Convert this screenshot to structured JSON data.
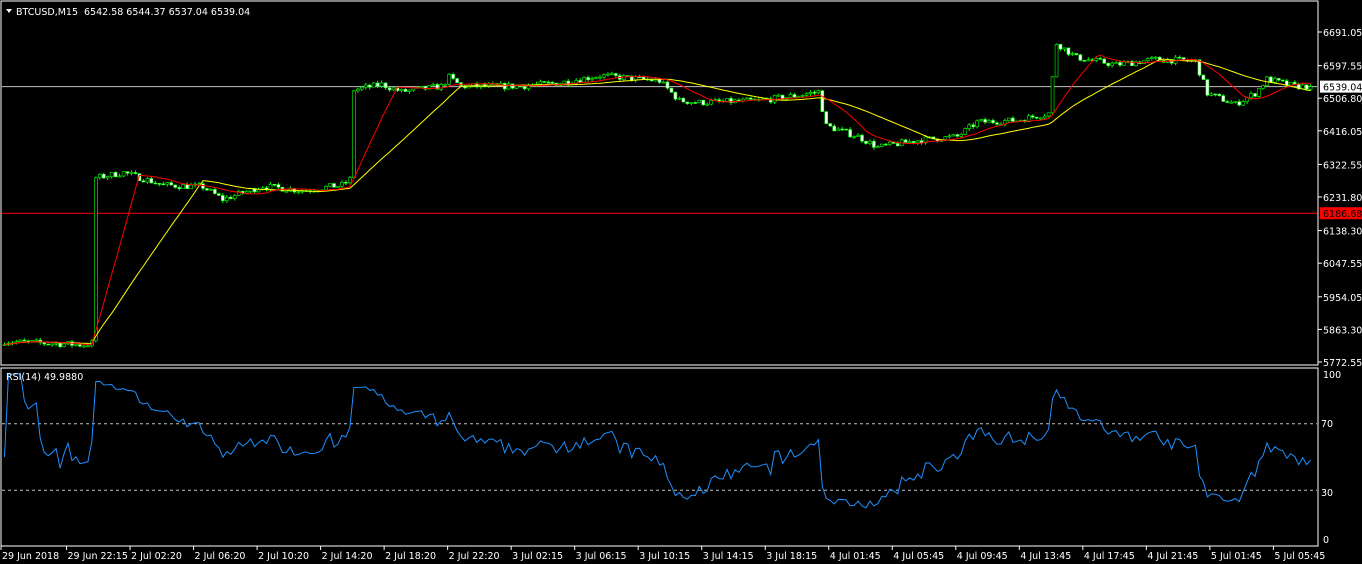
{
  "header": {
    "symbol": "BTCUSD,M15",
    "ohlc": "6542.58 6544.37 6537.04 6539.04"
  },
  "rsi_panel": {
    "label": "RSI(14) 49.9880",
    "levels": [
      "100",
      "70",
      "30",
      "0"
    ]
  },
  "price_axis": {
    "ticks": [
      "6691.05",
      "6597.55",
      "6506.80",
      "6416.05",
      "6322.55",
      "6231.80",
      "6138.30",
      "6047.55",
      "5954.05",
      "5863.30",
      "5772.55"
    ],
    "current_price_label": "6539.04",
    "line_price_label": "6186.68"
  },
  "time_axis": {
    "labels": [
      "29 Jun 2018",
      "29 Jun 22:15",
      "2 Jul 02:20",
      "2 Jul 06:20",
      "2 Jul 10:20",
      "2 Jul 14:20",
      "2 Jul 18:20",
      "2 Jul 22:20",
      "3 Jul 02:15",
      "3 Jul 06:15",
      "3 Jul 10:15",
      "3 Jul 14:15",
      "3 Jul 18:15",
      "4 Jul 01:45",
      "4 Jul 05:45",
      "4 Jul 09:45",
      "4 Jul 13:45",
      "4 Jul 17:45",
      "4 Jul 21:45",
      "5 Jul 01:45",
      "5 Jul 05:45"
    ]
  },
  "colors": {
    "background": "#000000",
    "candle": "#00ff00",
    "bull_body": "#000000",
    "bear_body": "#ffffff",
    "ma_fast": "#ff0000",
    "ma_slow": "#ffff00",
    "rsi": "#1e90ff",
    "current_price_line": "#c0c0c0",
    "hline": "#ff0000"
  },
  "chart_data": {
    "type": "candlestick",
    "symbol": "BTCUSD",
    "timeframe": "M15",
    "price_range": [
      5772.55,
      6691.05
    ],
    "bars": 330,
    "bars_per_time_label": 16,
    "close_keypoints": [
      [
        0,
        5830
      ],
      [
        20,
        5820
      ],
      [
        22,
        5825
      ],
      [
        23,
        6285
      ],
      [
        30,
        6300
      ],
      [
        40,
        6265
      ],
      [
        50,
        6260
      ],
      [
        55,
        6225
      ],
      [
        65,
        6262
      ],
      [
        75,
        6250
      ],
      [
        85,
        6265
      ],
      [
        87,
        6280
      ],
      [
        88,
        6530
      ],
      [
        95,
        6545
      ],
      [
        100,
        6525
      ],
      [
        110,
        6540
      ],
      [
        112,
        6565
      ],
      [
        115,
        6540
      ],
      [
        130,
        6540
      ],
      [
        140,
        6550
      ],
      [
        150,
        6570
      ],
      [
        165,
        6555
      ],
      [
        170,
        6500
      ],
      [
        175,
        6495
      ],
      [
        190,
        6500
      ],
      [
        200,
        6515
      ],
      [
        205,
        6525
      ],
      [
        207,
        6430
      ],
      [
        215,
        6400
      ],
      [
        220,
        6370
      ],
      [
        230,
        6390
      ],
      [
        240,
        6400
      ],
      [
        245,
        6440
      ],
      [
        255,
        6445
      ],
      [
        263,
        6465
      ],
      [
        265,
        6660
      ],
      [
        270,
        6620
      ],
      [
        280,
        6600
      ],
      [
        290,
        6615
      ],
      [
        300,
        6610
      ],
      [
        303,
        6520
      ],
      [
        310,
        6490
      ],
      [
        315,
        6520
      ],
      [
        318,
        6560
      ],
      [
        325,
        6540
      ],
      [
        329,
        6539.04
      ]
    ],
    "ma_fast_period": 12,
    "ma_slow_period": 28,
    "rsi_period": 14,
    "rsi_levels": [
      70,
      30
    ],
    "rsi_range": [
      0,
      100
    ],
    "current_price": 6539.04,
    "horizontal_line": 6186.68
  }
}
